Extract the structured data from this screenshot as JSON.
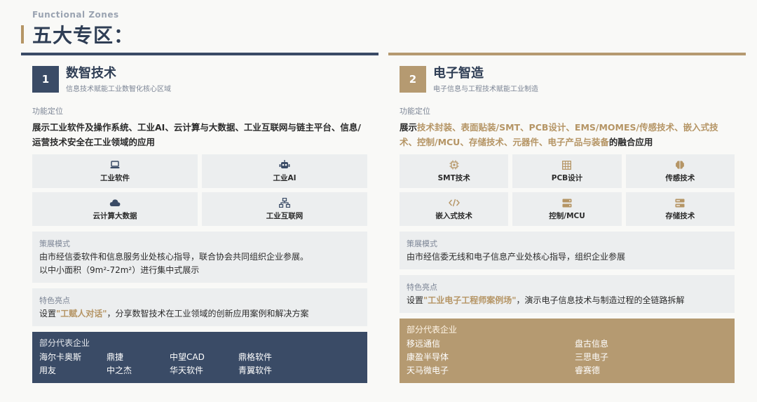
{
  "header": {
    "en": "Functional Zones",
    "title": "五大专区："
  },
  "zones": [
    {
      "num": "1",
      "name": "数智技术",
      "sub": "信息技术赋能工业数智化核心区域",
      "pos_label": "功能定位",
      "pos_text": "展示工业软件及操作系统、工业AI、云计算与大数据、工业互联网与链主平台、信息/运营技术安全在工业领域的应用",
      "tiles": [
        {
          "label": "工业软件",
          "icon": "laptop-icon"
        },
        {
          "label": "工业AI",
          "icon": "robot-icon"
        },
        {
          "label": "云计算大数据",
          "icon": "cloud-icon"
        },
        {
          "label": "工业互联网",
          "icon": "network-icon"
        }
      ],
      "mode_label": "策展模式",
      "mode_text1": "由市经信委软件和信息服务业处核心指导，联合协会共同组织企业参展。",
      "mode_text2": "以中小面积（9m²-72m²）进行集中式展示",
      "feat_label": "特色亮点",
      "feat_pre": "设置",
      "feat_hl": "\"工赋人对话\"",
      "feat_post": "，分享数智技术在工业领域的创新应用案例和解决方案",
      "corp_label": "部分代表企业",
      "corps": [
        "海尔卡奥斯",
        "鼎捷",
        "中望CAD",
        "鼎格软件",
        "用友",
        "中之杰",
        "华天软件",
        "青翼软件"
      ]
    },
    {
      "num": "2",
      "name": "电子智造",
      "sub": "电子信息与工程技术赋能工业制造",
      "pos_label": "功能定位",
      "pos_pre": "展示",
      "pos_hl": "技术封装、表面贴装/SMT、PCB设计、EMS/MOMES/传感技术、嵌入式技术、控制/MCU、存储技术、元器件、电子产品与装备",
      "pos_post": "的融合应用",
      "tiles": [
        {
          "label": "SMT技术",
          "icon": "chip-icon"
        },
        {
          "label": "PCB设计",
          "icon": "board-icon"
        },
        {
          "label": "传感技术",
          "icon": "brain-icon"
        },
        {
          "label": "嵌入式技术",
          "icon": "code-icon"
        },
        {
          "label": "控制/MCU",
          "icon": "server-icon"
        },
        {
          "label": "存储技术",
          "icon": "storage-icon"
        }
      ],
      "mode_label": "策展模式",
      "mode_text1": "由市经信委无线和电子信息产业处核心指导，组织企业参展",
      "feat_label": "特色亮点",
      "feat_pre": "设置",
      "feat_hl": "\"工业电子工程师案例场\"",
      "feat_post": "，演示电子信息技术与制造过程的全链路拆解",
      "corp_label": "部分代表企业",
      "corps": [
        "移远通信",
        "盘古信息",
        "康盈半导体",
        "三思电子",
        "天马微电子",
        "睿赛德"
      ]
    }
  ],
  "colors": {
    "navy": "#3a4b66",
    "gold": "#b59a71",
    "highlight": "#b59565"
  }
}
